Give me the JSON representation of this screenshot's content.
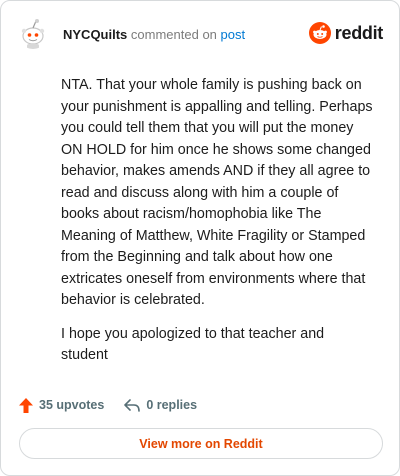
{
  "comment": {
    "username": "NYCQuilts",
    "action": "commented on",
    "post_link": "post",
    "paragraphs": [
      "NTA. That your whole family is pushing back on your punishment is appalling and telling. Perhaps you could tell them that you will put the money ON HOLD for him once he shows some changed behavior, makes amends AND if they all agree to read and discuss along with him a couple of books about racism/homophobia like The Meaning of Matthew, White Fragility or Stamped from the Beginning and talk about how one extricates oneself from environments where that behavior is celebrated.",
      "I hope you apologized to that teacher and student"
    ]
  },
  "brand": {
    "wordmark": "reddit",
    "color": "#ff4500"
  },
  "stats": {
    "upvotes": "35 upvotes",
    "replies": "0 replies",
    "upvote_color": "#ff4500"
  },
  "footer": {
    "view_more_label": "View more on Reddit"
  },
  "icons": {
    "avatar": "snoo-avatar-icon",
    "brand": "reddit-logo-icon",
    "upvote": "upvote-arrow-icon",
    "reply": "reply-arrow-icon"
  }
}
